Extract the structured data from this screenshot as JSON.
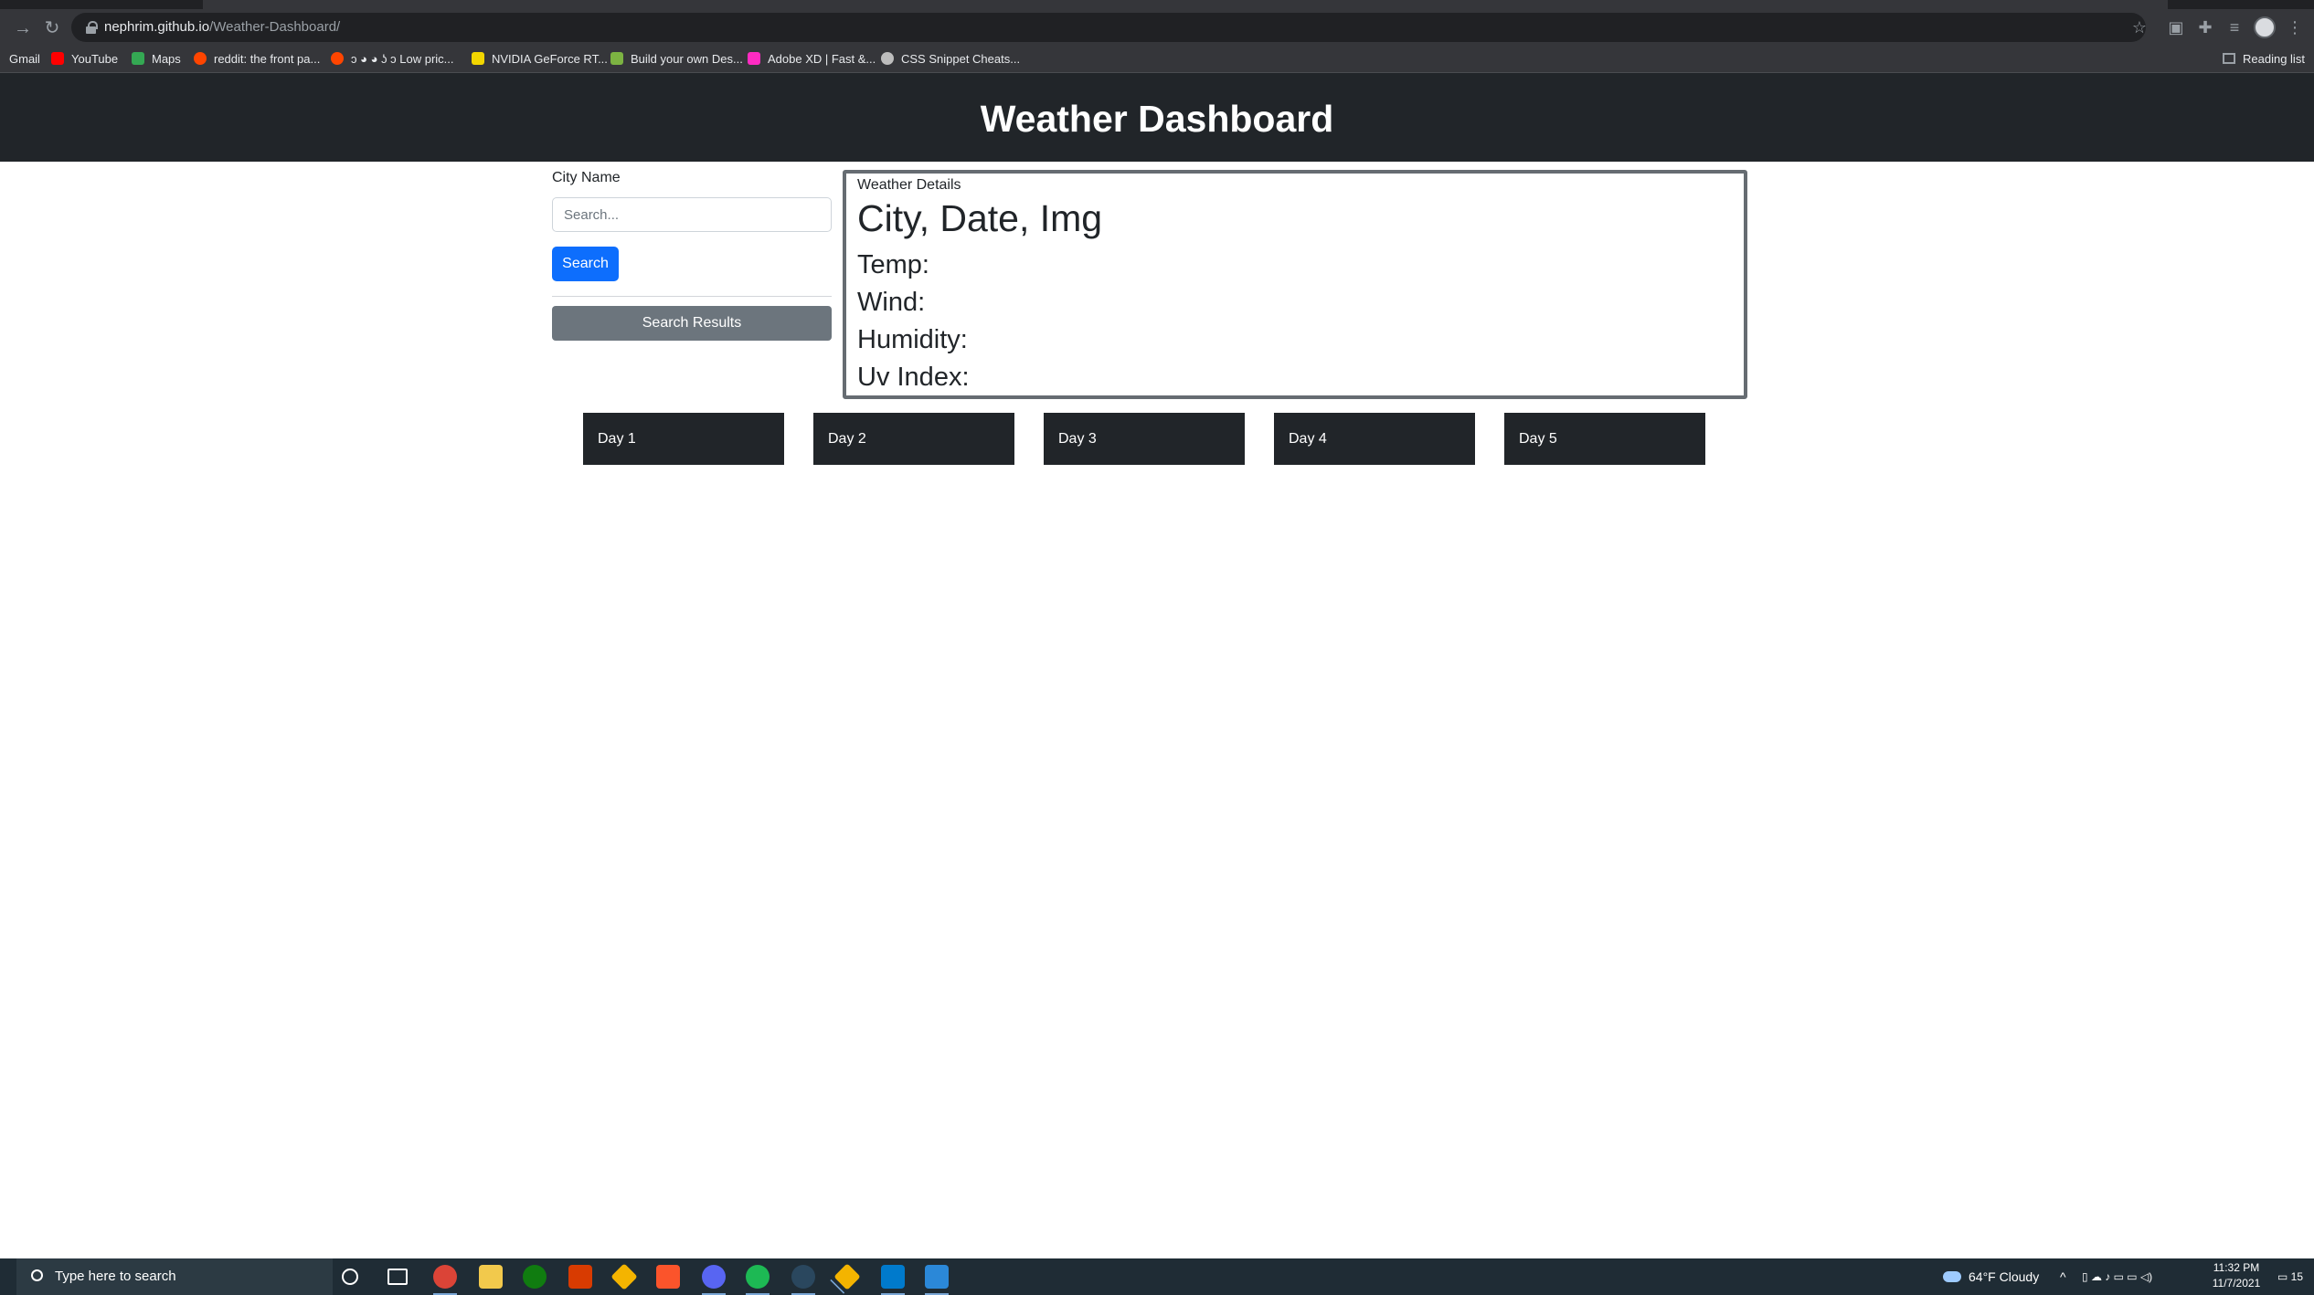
{
  "browser": {
    "url_host": "nephrim.github.io",
    "url_path": "/Weather-Dashboard/",
    "bookmarks": [
      {
        "label": "Gmail",
        "color": "#ea4335"
      },
      {
        "label": "YouTube",
        "color": "#ff0000"
      },
      {
        "label": "Maps",
        "color": "#34a853"
      },
      {
        "label": "reddit: the front pa...",
        "color": "#ff4500"
      },
      {
        "label": "ↄ ◕ ◕ ʖ ↄ Low pric...",
        "color": "#ff4500"
      },
      {
        "label": "NVIDIA GeForce RT...",
        "color": "#f2d600"
      },
      {
        "label": "Build your own Des...",
        "color": "#7cb342"
      },
      {
        "label": "Adobe XD | Fast &...",
        "color": "#ff2bc2"
      },
      {
        "label": "CSS Snippet Cheats...",
        "color": "#bdbdbd"
      }
    ],
    "reading_list_label": "Reading list"
  },
  "page": {
    "title": "Weather Dashboard",
    "search": {
      "label": "City Name",
      "placeholder": "Search...",
      "button_label": "Search",
      "results_button_label": "Search Results"
    },
    "details": {
      "caption": "Weather Details",
      "heading": "City, Date, Img",
      "temp_label": "Temp:",
      "wind_label": "Wind:",
      "humidity_label": "Humidity:",
      "uv_label": "Uv Index:"
    },
    "forecast_days": [
      "Day 1",
      "Day 2",
      "Day 3",
      "Day 4",
      "Day 5"
    ]
  },
  "taskbar": {
    "search_placeholder": "Type here to search",
    "weather": "64°F  Cloudy",
    "time": "11:32 PM",
    "date": "11/7/2021",
    "notification_count": "15"
  },
  "colors": {
    "header_bg": "#212529",
    "primary_button": "#0d6efd",
    "secondary_button": "#6c757d",
    "day_card_bg": "#212529"
  }
}
